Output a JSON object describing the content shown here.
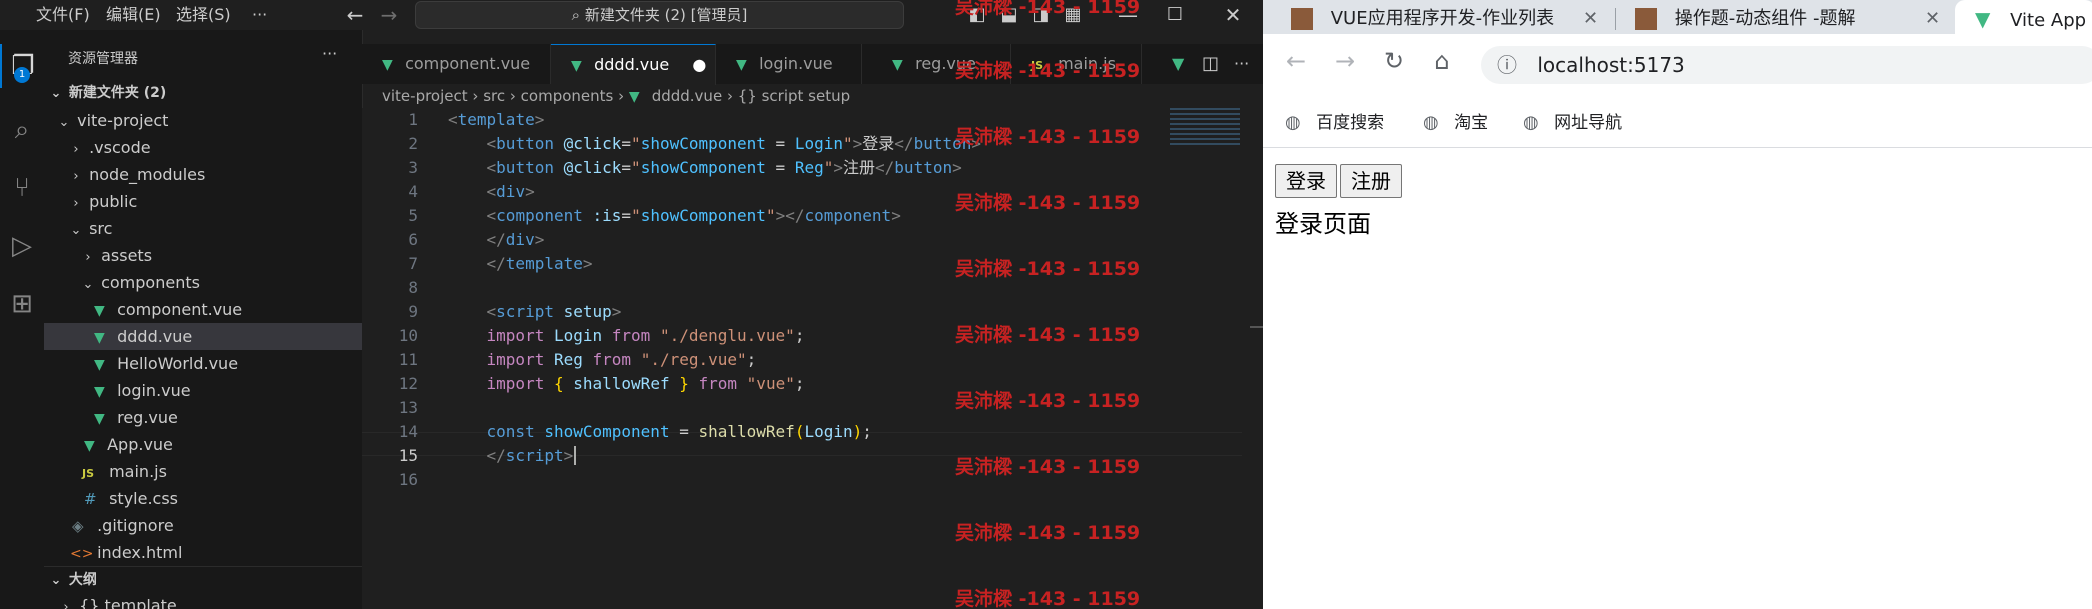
{
  "vscode": {
    "menu": [
      "文件(F)",
      "编辑(E)",
      "选择(S)",
      "···"
    ],
    "command_center": "新建文件夹 (2) [管理员]",
    "badge": "1",
    "sidebar": {
      "title": "资源管理器",
      "more": "···",
      "root": "新建文件夹 (2)",
      "tree": [
        "vite-project",
        ".vscode",
        "node_modules",
        "public",
        "src",
        "assets",
        "components",
        "component.vue",
        "dddd.vue",
        "HelloWorld.vue",
        "login.vue",
        "reg.vue",
        "App.vue",
        "main.js",
        "style.css",
        ".gitignore",
        "index.html"
      ],
      "outline": "大纲",
      "outline_child": "template"
    },
    "tabs": [
      "component.vue",
      "dddd.vue",
      "login.vue",
      "reg.vue",
      "main.js"
    ],
    "breadcrumb": [
      "vite-project",
      "src",
      "components",
      "dddd.vue",
      "{} script setup"
    ],
    "line_numbers": [
      "1",
      "2",
      "3",
      "4",
      "5",
      "6",
      "7",
      "8",
      "9",
      "10",
      "11",
      "12",
      "13",
      "14",
      "15",
      "16"
    ],
    "code": {
      "l2_label": "登录",
      "l3_label": "注册"
    },
    "watermark": "吴沛樑 -143 - 1159",
    "accent": "#0078d4"
  },
  "browser": {
    "tabs": [
      "VUE应用程序开发-作业列表",
      "操作题-动态组件 -题解",
      "Vite App"
    ],
    "url": "localhost:5173",
    "bookmarks": [
      "百度搜索",
      "淘宝",
      "网址导航"
    ],
    "page": {
      "login_button": "登录",
      "register_button": "注册",
      "content": "登录页面"
    }
  }
}
